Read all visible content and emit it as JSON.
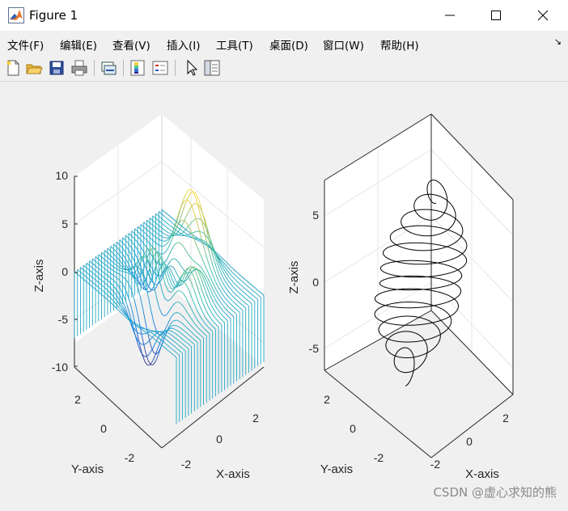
{
  "window": {
    "title": "Figure 1"
  },
  "menu": [
    "文件(F)",
    "编辑(E)",
    "查看(V)",
    "插入(I)",
    "工具(T)",
    "桌面(D)",
    "窗口(W)",
    "帮助(H)"
  ],
  "toolbar": [
    "new-figure-icon",
    "open-file-icon",
    "save-icon",
    "print-icon",
    "link-plot-icon",
    "colorbar-icon",
    "legend-icon",
    "pointer-arrow-icon",
    "property-inspector-icon"
  ],
  "left_plot": {
    "type": "waterfall",
    "xlabel": "X-axis",
    "ylabel": "Y-axis",
    "zlabel": "Z-axis",
    "zticks": [
      "10",
      "5",
      "0",
      "-5",
      "-10"
    ],
    "yticks": [
      "2",
      "0",
      "-2"
    ],
    "xticks": [
      "-2",
      "0",
      "2"
    ]
  },
  "right_plot": {
    "type": "line3d",
    "xlabel": "X-axis",
    "ylabel": "Y-axis",
    "zlabel": "Z-axis",
    "zticks": [
      "5",
      "0",
      "-5"
    ],
    "yticks": [
      "2",
      "0",
      "-2"
    ],
    "xticks": [
      "-2",
      "0",
      "2"
    ]
  },
  "watermark": "CSDN @虚心求知的熊",
  "chart_data": [
    {
      "type": "waterfall",
      "function": "peaks",
      "x_range": [
        -3,
        3
      ],
      "y_range": [
        -3,
        3
      ],
      "z_range": [
        -10,
        10
      ],
      "xlabel": "X-axis",
      "ylabel": "Y-axis",
      "zlabel": "Z-axis",
      "colormap": "parula"
    },
    {
      "type": "line3d",
      "x_range": [
        -3,
        3
      ],
      "y_range": [
        -3,
        3
      ],
      "z_range": [
        -7,
        7
      ],
      "xlabel": "X-axis",
      "ylabel": "Y-axis",
      "zlabel": "Z-axis",
      "line_color": "#000000"
    }
  ]
}
